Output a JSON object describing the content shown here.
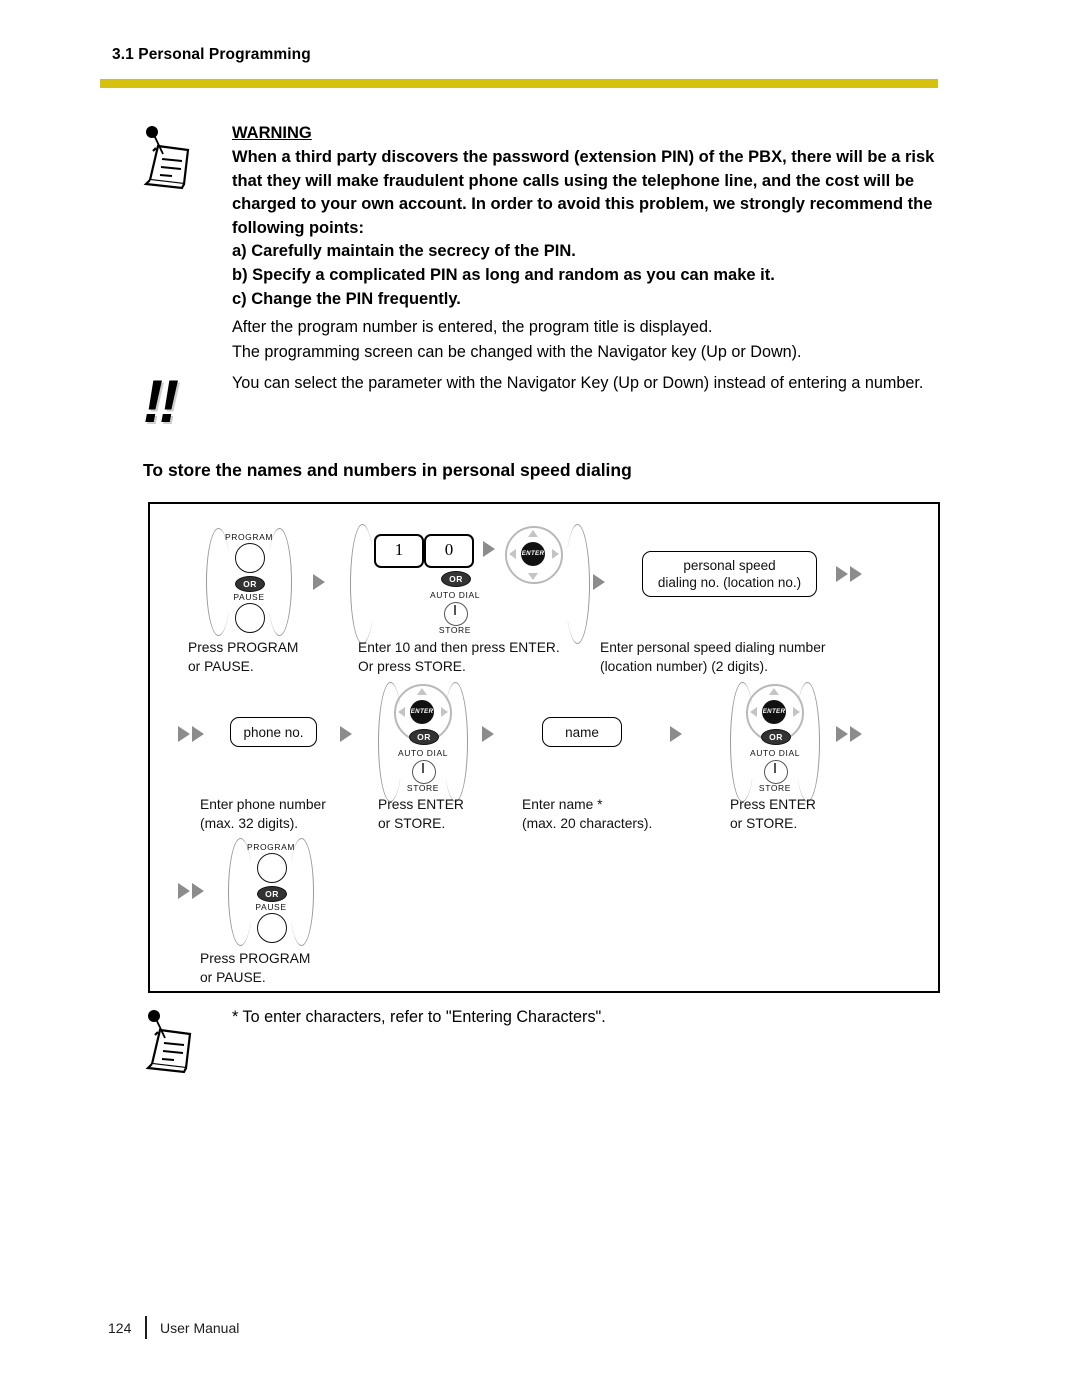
{
  "header": {
    "section": "3.1 Personal Programming",
    "rule_color": "#d6c20e"
  },
  "warning": {
    "title": "WARNING",
    "paragraph": "When a third party discovers the password (extension PIN) of the PBX, there will be a risk that they will make fraudulent phone calls using the telephone line, and the cost will be charged to your own account. In order to avoid this problem, we strongly recommend the following points:",
    "items": [
      "a) Carefully maintain the secrecy of the PIN.",
      "b) Specify a complicated PIN as long and random as you can make it.",
      "c) Change the PIN frequently."
    ],
    "notes": [
      "After the program number is entered, the program title is displayed.",
      "The programming screen can be changed with the Navigator key (Up or Down)."
    ],
    "icon": "note-icon"
  },
  "tip": {
    "icon": "double-exclamation-icon",
    "glyph": "!!",
    "text": "You can select the parameter with the Navigator Key (Up or Down) instead of entering a number."
  },
  "section_heading": "To store the names and numbers in personal speed dialing",
  "diagram": {
    "labels": {
      "program": "PROGRAM",
      "pause": "PAUSE",
      "or": "OR",
      "auto_dial": "AUTO DIAL",
      "store": "STORE",
      "enter": "ENTER"
    },
    "digits": [
      "1",
      "0"
    ],
    "boxes": {
      "speed_dialing": "personal speed\ndialing no. (location no.)",
      "speed_dialing_line1": "personal speed",
      "speed_dialing_line2": "dialing no. (location no.)",
      "phone_no": "phone no.",
      "name": "name"
    },
    "captions": {
      "step1_l1": "Press PROGRAM",
      "step1_l2": "or PAUSE.",
      "step2_l1": "Enter 10 and then press ENTER.",
      "step2_l2": "Or press STORE.",
      "step3_l1": "Enter personal speed dialing number",
      "step3_l2": "(location number)    (2 digits).",
      "step4_l1": "Enter phone number",
      "step4_l2": "(max. 32 digits).",
      "step5_l1": "Press ENTER",
      "step5_l2": "or STORE.",
      "step6_l1": "Enter name *",
      "step6_l2": "(max. 20 characters).",
      "step7_l1": "Press ENTER",
      "step7_l2": "or STORE.",
      "step8_l1": "Press PROGRAM",
      "step8_l2": "or PAUSE."
    }
  },
  "footnote": {
    "icon": "note-icon",
    "text": "* To enter characters, refer to \"Entering Characters\"."
  },
  "footer": {
    "page_number": "124",
    "label": "User Manual"
  }
}
